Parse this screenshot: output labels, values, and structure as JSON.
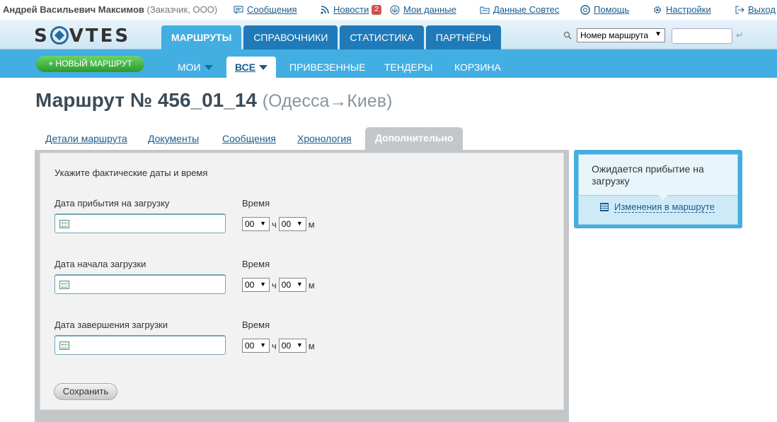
{
  "user": {
    "name": "Андрей Васильевич Максимов",
    "role": "(Заказчик, ООО)"
  },
  "toplinks": [
    {
      "label": "Сообщения",
      "icon": "message-icon"
    },
    {
      "label": "Новости",
      "icon": "rss-icon",
      "badge": "2"
    },
    {
      "label": "Мои данные",
      "icon": "coat-of-arms-icon"
    },
    {
      "label": "Данные Совтес",
      "icon": "folder-icon"
    },
    {
      "label": "Помощь",
      "icon": "lifebuoy-icon"
    },
    {
      "label": "Настройки",
      "icon": "gear-icon"
    },
    {
      "label": "Выход",
      "icon": "logout-icon"
    }
  ],
  "header": {
    "logo": "SOVTES",
    "main_tabs": [
      "МАРШРУТЫ",
      "СПРАВОЧНИКИ",
      "СТАТИСТИКА",
      "ПАРТНЁРЫ"
    ],
    "search_select": "Номер маршрута",
    "search_value": "",
    "enter_symbol": "↵"
  },
  "subnav": {
    "new_route": "+ НОВЫЙ МАРШРУТ",
    "tabs": [
      "МОИ",
      "ВСЕ",
      "ПРИВЕЗЕННЫЕ",
      "ТЕНДЕРЫ",
      "КОРЗИНА"
    ]
  },
  "title": {
    "main": "Маршрут № 456_01_14",
    "route": "(Одесса→Киев)"
  },
  "tabs": [
    "Детали маршрута",
    "Документы",
    "Сообщения",
    "Хронология",
    "Дополнительно"
  ],
  "form": {
    "instruction": "Укажите фактические даты и время",
    "time_label": "Время",
    "hour_unit": "ч",
    "min_unit": "м",
    "fields": [
      {
        "label": "Дата прибытия на загрузку",
        "hour": "00",
        "min": "00"
      },
      {
        "label": "Дата начала загрузки",
        "hour": "00",
        "min": "00"
      },
      {
        "label": "Дата завершения загрузки",
        "hour": "00",
        "min": "00"
      }
    ],
    "save": "Сохранить"
  },
  "status": {
    "text": "Ожидается прибытие на загрузку",
    "changes_link": "Изменения в маршруте"
  },
  "colors": {
    "accent": "#42aee2",
    "dark_tab": "#1e7ab8",
    "green": "#2a9a2a"
  }
}
